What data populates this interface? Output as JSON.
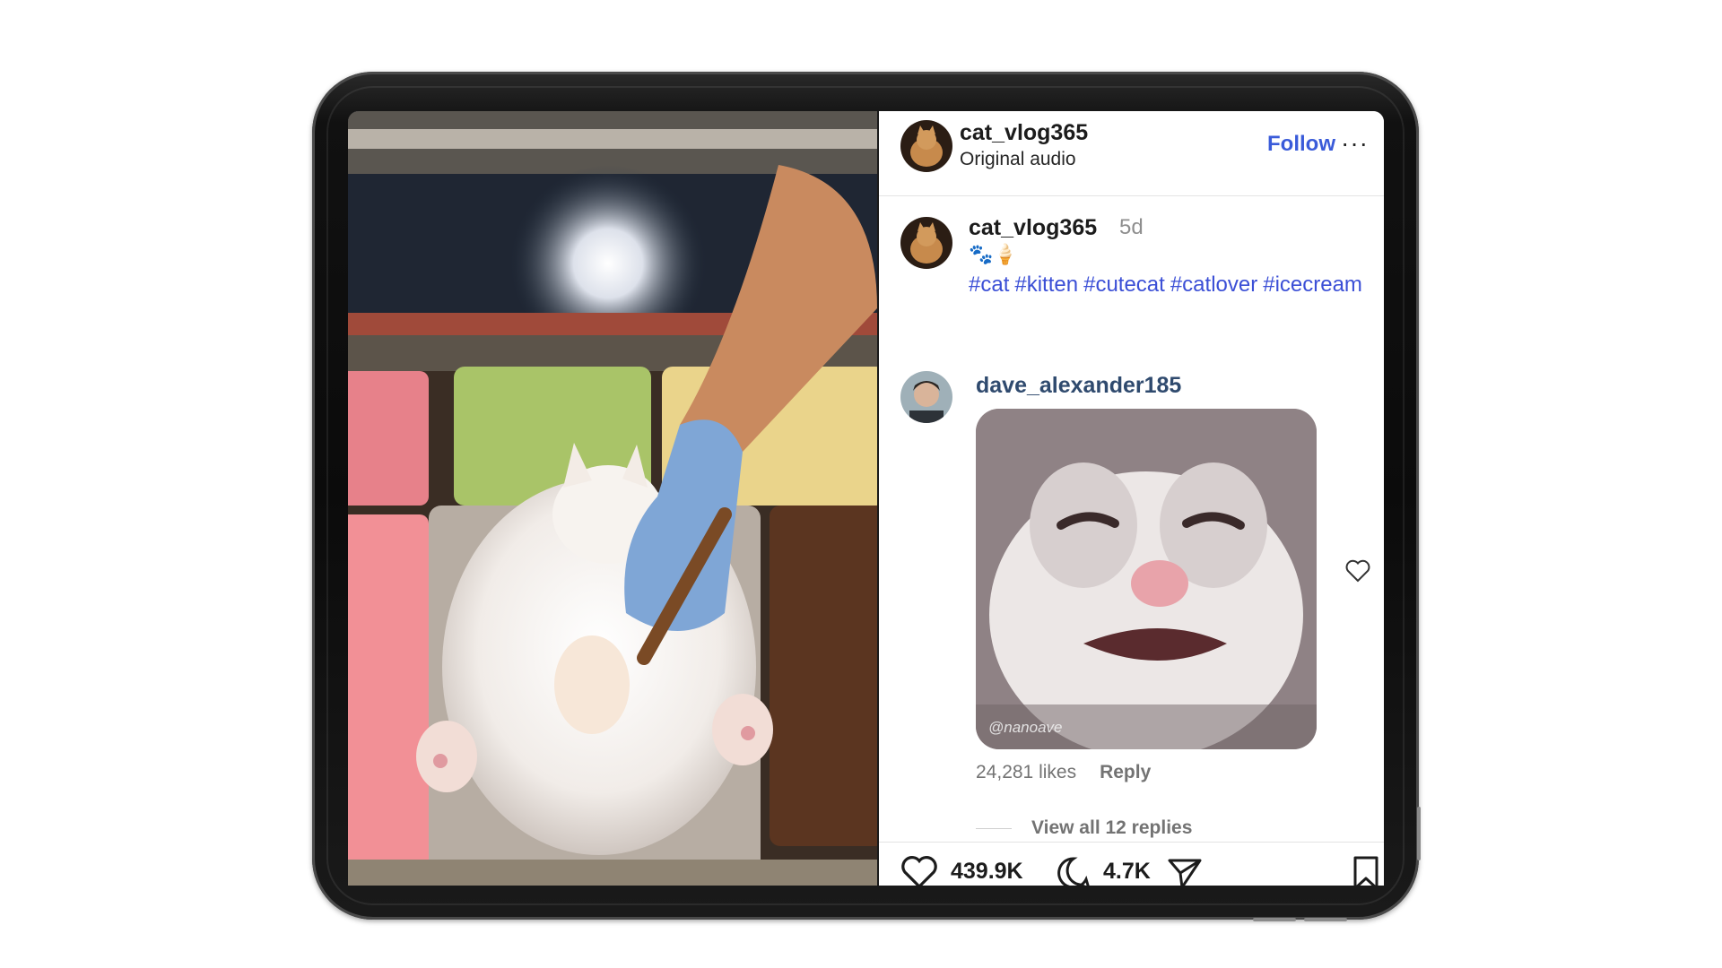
{
  "post": {
    "author": "cat_vlog365",
    "audio": "Original audio",
    "follow_label": "Follow",
    "more_label": "···"
  },
  "caption": {
    "author": "cat_vlog365",
    "age": "5d",
    "emoji": "🐾🍦",
    "hashtags": [
      "#cat",
      "#kitten",
      "#cutecat",
      "#catlover",
      "#icecream"
    ]
  },
  "comment": {
    "author": "dave_alexander185",
    "gif_watermark": "@nanoave",
    "likes": "24,281 likes",
    "reply_label": "Reply",
    "view_replies": "View all 12 replies"
  },
  "actions": {
    "likes": "439.9K",
    "comments": "4.7K"
  },
  "icons": {
    "like": "heart-icon",
    "comment": "comment-icon",
    "share": "share-icon",
    "save": "bookmark-icon",
    "more": "more-icon"
  },
  "colors": {
    "accent": "#3a5bd9",
    "hashtag": "#3b4fd6",
    "text": "#1c1c1c",
    "muted": "#737373"
  }
}
